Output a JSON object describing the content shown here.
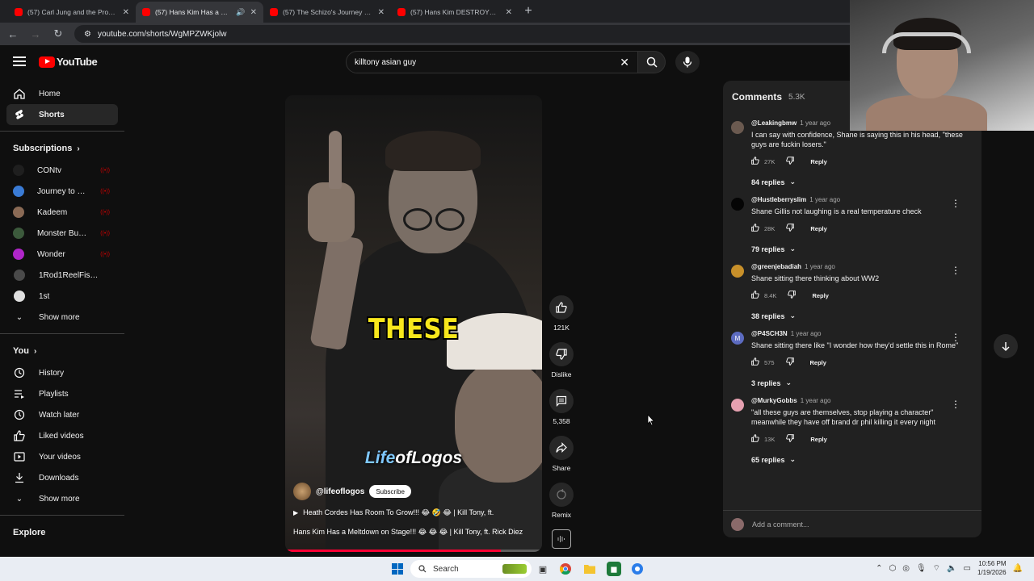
{
  "browser": {
    "tabs": [
      {
        "title": "(57) Carl Jung and the Prophec",
        "active": false
      },
      {
        "title": "(57) Hans Kim Has a Meltdo",
        "active": true
      },
      {
        "title": "(57) The Schizo's Journey - Fro",
        "active": false
      },
      {
        "title": "(57) Hans Kim DESTROYS His O",
        "active": false
      }
    ],
    "url": "youtube.com/shorts/WgMPZWKjolw"
  },
  "header": {
    "logo_text": "YouTube",
    "search_value": "killtony asian guy"
  },
  "sidebar": {
    "main": [
      {
        "label": "Home",
        "icon": "home-icon"
      },
      {
        "label": "Shorts",
        "icon": "shorts-icon",
        "active": true
      }
    ],
    "subscriptions_title": "Subscriptions",
    "subscriptions": [
      {
        "name": "CONtv",
        "color": "#1f1f1f",
        "live": true
      },
      {
        "name": "Journey to the M...",
        "color": "#3a7bd5",
        "live": true
      },
      {
        "name": "Kadeem",
        "color": "#8a6a55",
        "live": true
      },
      {
        "name": "Monster Bug Wa...",
        "color": "#3c5a3c",
        "live": true
      },
      {
        "name": "Wonder",
        "color": "#b026c9",
        "live": true
      },
      {
        "name": "1Rod1ReelFishing",
        "color": "#4a4a4a",
        "live": false
      },
      {
        "name": "1st",
        "color": "#e0e0e0",
        "live": false
      }
    ],
    "show_more_1": "Show more",
    "you_title": "You",
    "you_items": [
      {
        "label": "History",
        "icon": "history-icon"
      },
      {
        "label": "Playlists",
        "icon": "playlists-icon"
      },
      {
        "label": "Watch later",
        "icon": "watch-later-icon"
      },
      {
        "label": "Liked videos",
        "icon": "liked-videos-icon"
      },
      {
        "label": "Your videos",
        "icon": "your-videos-icon"
      },
      {
        "label": "Downloads",
        "icon": "downloads-icon"
      }
    ],
    "show_more_2": "Show more",
    "explore_title": "Explore"
  },
  "short": {
    "caption": "THESE",
    "watermark_a": "Life",
    "watermark_b": "ofLogos",
    "channel": "@lifeoflogos",
    "subscribe_label": "Subscribe",
    "music_line": "Heath Cordes Has Room To Grow!!! 😂 🤣 😂 | Kill Tony, ft.",
    "title": "Hans Kim Has a Meltdown on Stage!!! 😂 😂 😂 | Kill Tony, ft. Rick Diez",
    "progress": 0.84
  },
  "actions": {
    "like_count": "121K",
    "dislike_label": "Dislike",
    "comment_count": "5,358",
    "share_label": "Share",
    "remix_label": "Remix"
  },
  "comments": {
    "title": "Comments",
    "count": "5.3K",
    "add_placeholder": "Add a comment...",
    "reply_label": "Reply",
    "items": [
      {
        "user": "@Leakingbmw",
        "when": "1 year ago",
        "text": "I can say with confidence, Shane is saying this in his head, \"these guys are fuckin losers.\"",
        "likes": "27K",
        "replies": "84 replies",
        "avatar": "#6b5a50"
      },
      {
        "user": "@Hustleberryslim",
        "when": "1 year ago",
        "text": "Shane Gillis not laughing is a real temperature check",
        "likes": "28K",
        "replies": "79 replies",
        "avatar": "#050505"
      },
      {
        "user": "@greenjebadiah",
        "when": "1 year ago",
        "text": "Shane sitting there thinking about WW2",
        "likes": "8.4K",
        "replies": "38 replies",
        "avatar": "#c8902a"
      },
      {
        "user": "@P4SCH3N",
        "when": "1 year ago",
        "text": "Shane sitting there like \"I wonder how they'd settle this in Rome\"",
        "likes": "575",
        "replies": "3 replies",
        "avatar": "#5c6bc0",
        "initial": "M"
      },
      {
        "user": "@MurkyGobbs",
        "when": "1 year ago",
        "text": "\"all these guys are themselves, stop playing a character\" meanwhile they have off brand dr phil killing it every night",
        "likes": "13K",
        "replies": "65 replies",
        "avatar": "#e5a0b0"
      }
    ]
  },
  "taskbar": {
    "search_label": "Search",
    "time": "10:56 PM",
    "date": "1/19/2026"
  }
}
